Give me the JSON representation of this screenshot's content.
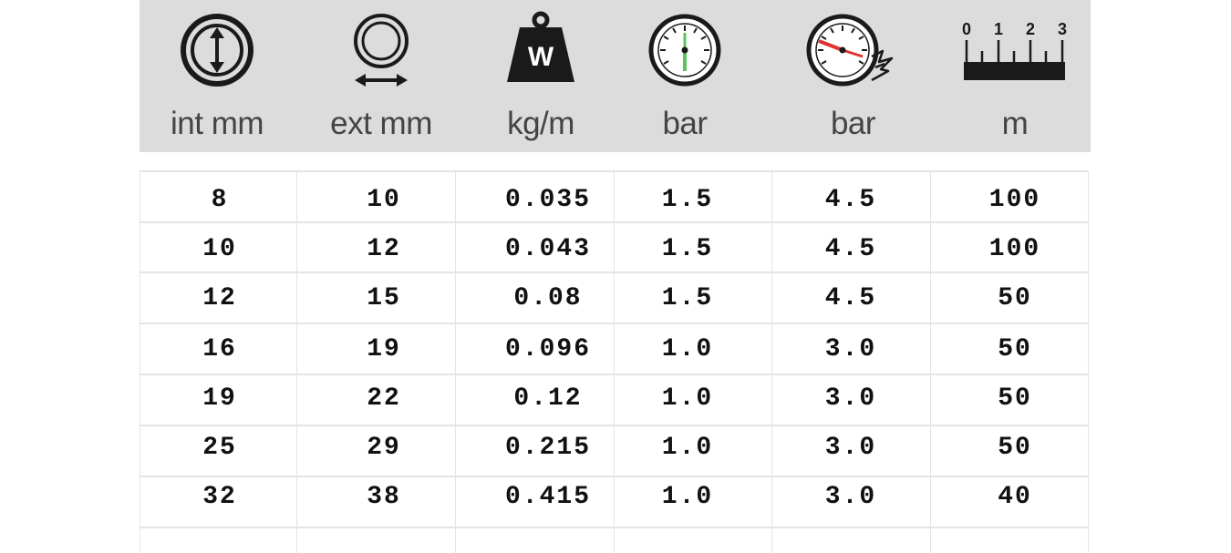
{
  "columns": [
    {
      "icon": "inner-diameter-icon",
      "unit": "int mm"
    },
    {
      "icon": "outer-diameter-icon",
      "unit": "ext mm"
    },
    {
      "icon": "weight-icon",
      "icon_text": "W",
      "unit": "kg/m"
    },
    {
      "icon": "working-pressure-gauge-icon",
      "unit": "bar"
    },
    {
      "icon": "burst-pressure-gauge-icon",
      "unit": "bar"
    },
    {
      "icon": "length-ruler-icon",
      "ruler_labels": [
        "0",
        "1",
        "2",
        "3"
      ],
      "unit": "m"
    }
  ],
  "rows": [
    [
      "8",
      "10",
      "0.035",
      "1.5",
      "4.5",
      "100"
    ],
    [
      "10",
      "12",
      "0.043",
      "1.5",
      "4.5",
      "100"
    ],
    [
      "12",
      "15",
      "0.08",
      "1.5",
      "4.5",
      "50"
    ],
    [
      "16",
      "19",
      "0.096",
      "1.0",
      "3.0",
      "50"
    ],
    [
      "19",
      "22",
      "0.12",
      "1.0",
      "3.0",
      "50"
    ],
    [
      "25",
      "29",
      "0.215",
      "1.0",
      "3.0",
      "50"
    ],
    [
      "32",
      "38",
      "0.415",
      "1.0",
      "3.0",
      "40"
    ]
  ],
  "colors": {
    "header_bg": "#dcdcdc",
    "gauge_needle_green": "#5cc35a",
    "gauge_needle_red": "#e0322f"
  }
}
